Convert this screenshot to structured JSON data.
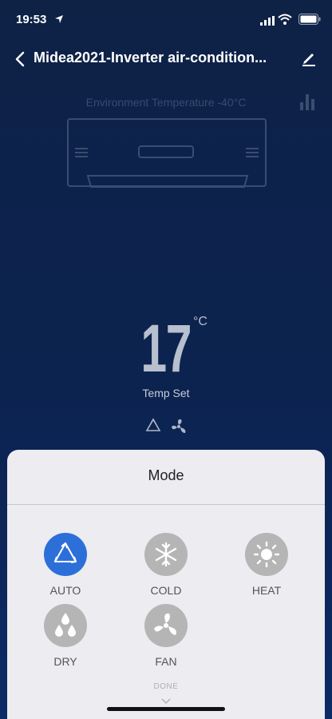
{
  "status_bar": {
    "time": "19:53"
  },
  "header": {
    "title": "Midea2021-Inverter air-condition..."
  },
  "environment": {
    "text": "Environment Temperature -40°C"
  },
  "temperature": {
    "value": "17",
    "unit": "°C",
    "label": "Temp Set"
  },
  "mode_sheet": {
    "title": "Mode",
    "modes": [
      {
        "label": "AUTO",
        "icon": "recycle-icon",
        "active": true
      },
      {
        "label": "COLD",
        "icon": "snowflake-icon",
        "active": false
      },
      {
        "label": "HEAT",
        "icon": "sun-icon",
        "active": false
      },
      {
        "label": "DRY",
        "icon": "droplets-icon",
        "active": false
      },
      {
        "label": "FAN",
        "icon": "fan-icon",
        "active": false
      }
    ],
    "done_label": "DONE"
  },
  "colors": {
    "accent": "#2d6fd8",
    "inactive_mode": "#b5b5b5",
    "background": "#0c2350",
    "sheet": "#ececf1"
  }
}
